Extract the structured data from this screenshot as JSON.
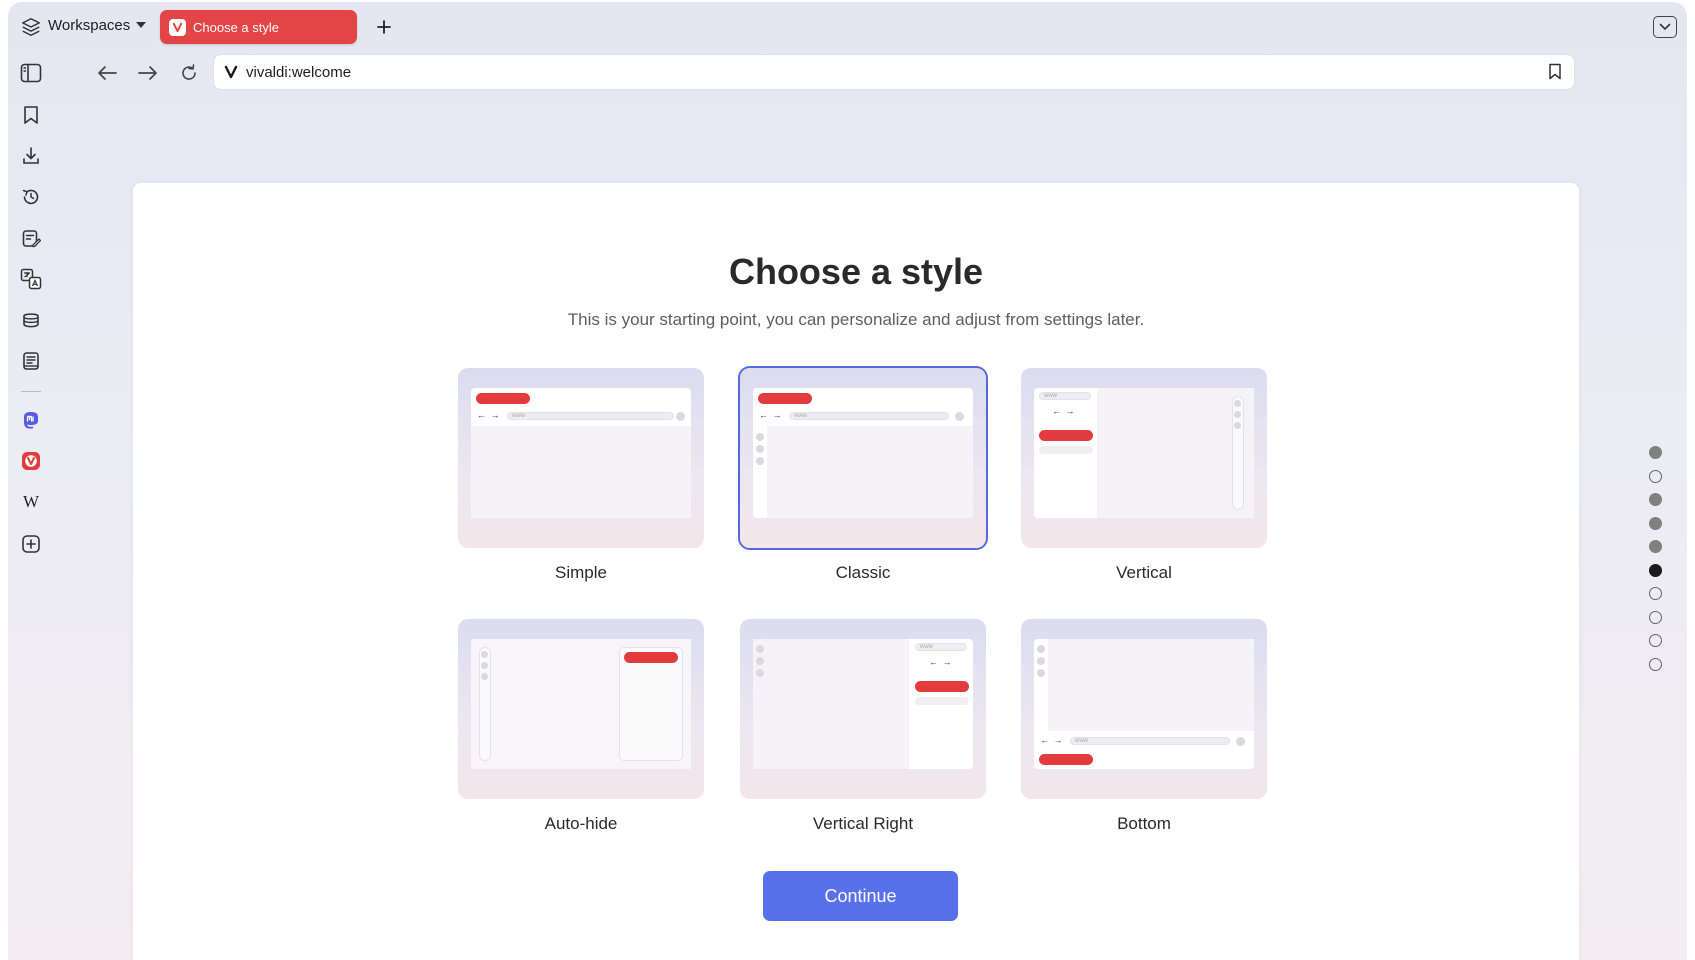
{
  "browser": {
    "workspaces_label": "Workspaces",
    "tab_title": "Choose a style",
    "url": "vivaldi:welcome",
    "accent_color": "#e34445"
  },
  "page": {
    "title": "Choose a style",
    "subtitle": "This is your starting point, you can personalize and adjust from settings later.",
    "continue_label": "Continue",
    "accent_color": "#5870ea",
    "styles": [
      {
        "label": "Simple",
        "selected": false
      },
      {
        "label": "Classic",
        "selected": true
      },
      {
        "label": "Vertical",
        "selected": false
      },
      {
        "label": "Auto-hide",
        "selected": false
      },
      {
        "label": "Vertical Right",
        "selected": false
      },
      {
        "label": "Bottom",
        "selected": false
      }
    ],
    "mockup_text": "www",
    "mockup_arrows": "← →"
  },
  "side_panel": {
    "icons": [
      "panel-toggle-icon",
      "bookmark-icon",
      "download-icon",
      "history-icon",
      "notes-icon",
      "translate-icon",
      "reading-list-icon",
      "reader-icon",
      "mastodon-icon",
      "vivaldi-icon",
      "wikipedia-icon",
      "add-panel-icon"
    ],
    "wikipedia_glyph": "W"
  },
  "progress": {
    "total_steps": 10,
    "current_step": 6
  }
}
